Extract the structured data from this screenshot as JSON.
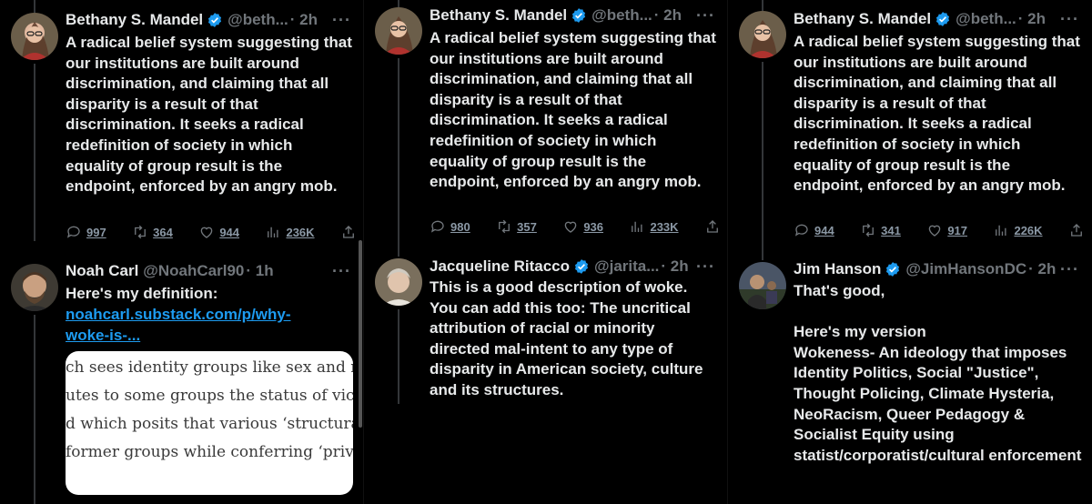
{
  "panels": [
    {
      "top_tweet": {
        "name": "Bethany S. Mandel",
        "handle": "@beth...",
        "time": "· 2h",
        "more": "···",
        "text": "A radical belief system suggesting that our institutions are built around discrimination, and claiming that all disparity is a result of that discrimination. It seeks a radical redefinition of society in which equality of group result is the endpoint, enforced by an angry mob.",
        "replies": "997",
        "retweets": "364",
        "likes": "944",
        "views": "236K"
      },
      "reply": {
        "name": "Noah Carl",
        "handle": "@NoahCarl90",
        "time": "· 1h",
        "more": "···",
        "text": "Here's my definition:",
        "link": "noahcarl.substack.com/p/why-woke-is-...",
        "card_lines": [
          "ch sees identity groups like sex and ra",
          "utes to some groups the status of vict",
          "d which posits that various ‘structura",
          " former groups while conferring ‘privi"
        ]
      }
    },
    {
      "top_tweet": {
        "name": "Bethany S. Mandel",
        "handle": "@beth...",
        "time": "· 2h",
        "more": "···",
        "text": "A radical belief system suggesting that our institutions are built around discrimination, and claiming that all disparity is a result of that discrimination. It seeks a radical redefinition of society in which equality of group result is the endpoint, enforced by an angry mob.",
        "replies": "980",
        "retweets": "357",
        "likes": "936",
        "views": "233K"
      },
      "reply": {
        "name": "Jacqueline Ritacco",
        "handle": "@jarita...",
        "time": "· 2h",
        "more": "···",
        "text": "This is a good description of woke. You can add this too: The uncritical attribution of racial or minority directed mal-intent to any type of disparity in American society, culture and its structures."
      }
    },
    {
      "top_tweet": {
        "name": "Bethany S. Mandel",
        "handle": "@beth...",
        "time": "· 2h",
        "more": "···",
        "text": "A radical belief system suggesting that our institutions are built around discrimination, and claiming that all disparity is a result of that discrimination. It seeks a radical redefinition of society in which equality of group result is the endpoint, enforced by an angry mob.",
        "replies": "944",
        "retweets": "341",
        "likes": "917",
        "views": "226K"
      },
      "reply": {
        "name": "Jim Hanson",
        "handle": "@JimHansonDC",
        "time": "· 2h",
        "more": "···",
        "text": "That's good,\n\nHere's my version\nWokeness- An ideology that imposes Identity Politics, Social \"Justice\", Thought Policing, Climate Hysteria, NeoRacism, Queer Pedagogy & Socialist Equity using statist/corporatist/cultural enforcement"
      }
    }
  ],
  "colors": {
    "background": "#000000",
    "text": "#e7e9ea",
    "muted": "#71767b",
    "link": "#1d9bf0",
    "verified": "#1d9bf0"
  },
  "icons": [
    "verified-badge-icon",
    "more-icon",
    "reply-icon",
    "retweet-icon",
    "like-icon",
    "views-icon",
    "share-icon"
  ]
}
